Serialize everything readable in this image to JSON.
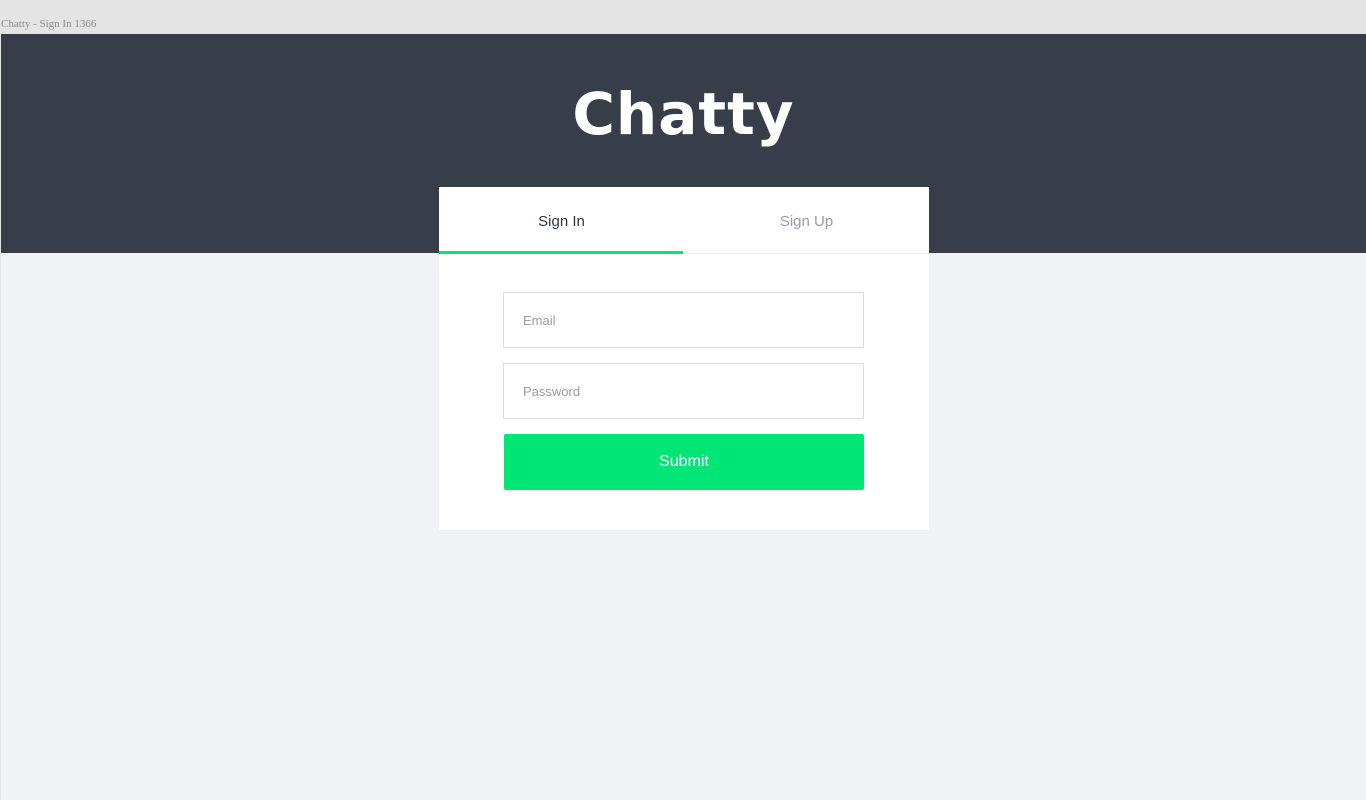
{
  "frame": {
    "label": "Chatty - Sign In 1366"
  },
  "header": {
    "brand": "Chatty"
  },
  "auth_card": {
    "tabs": [
      {
        "label": "Sign In",
        "active": true
      },
      {
        "label": "Sign Up",
        "active": false
      }
    ],
    "email": {
      "value": "",
      "placeholder": "Email"
    },
    "password": {
      "value": "",
      "placeholder": "Password"
    },
    "submit_label": "Submit"
  },
  "colors": {
    "header_bg": "#373e49",
    "page_bg": "#f1f2f6",
    "accent": "#00e676",
    "active_tab_text": "#2f3540",
    "inactive_tab_text": "#9a9da3"
  }
}
